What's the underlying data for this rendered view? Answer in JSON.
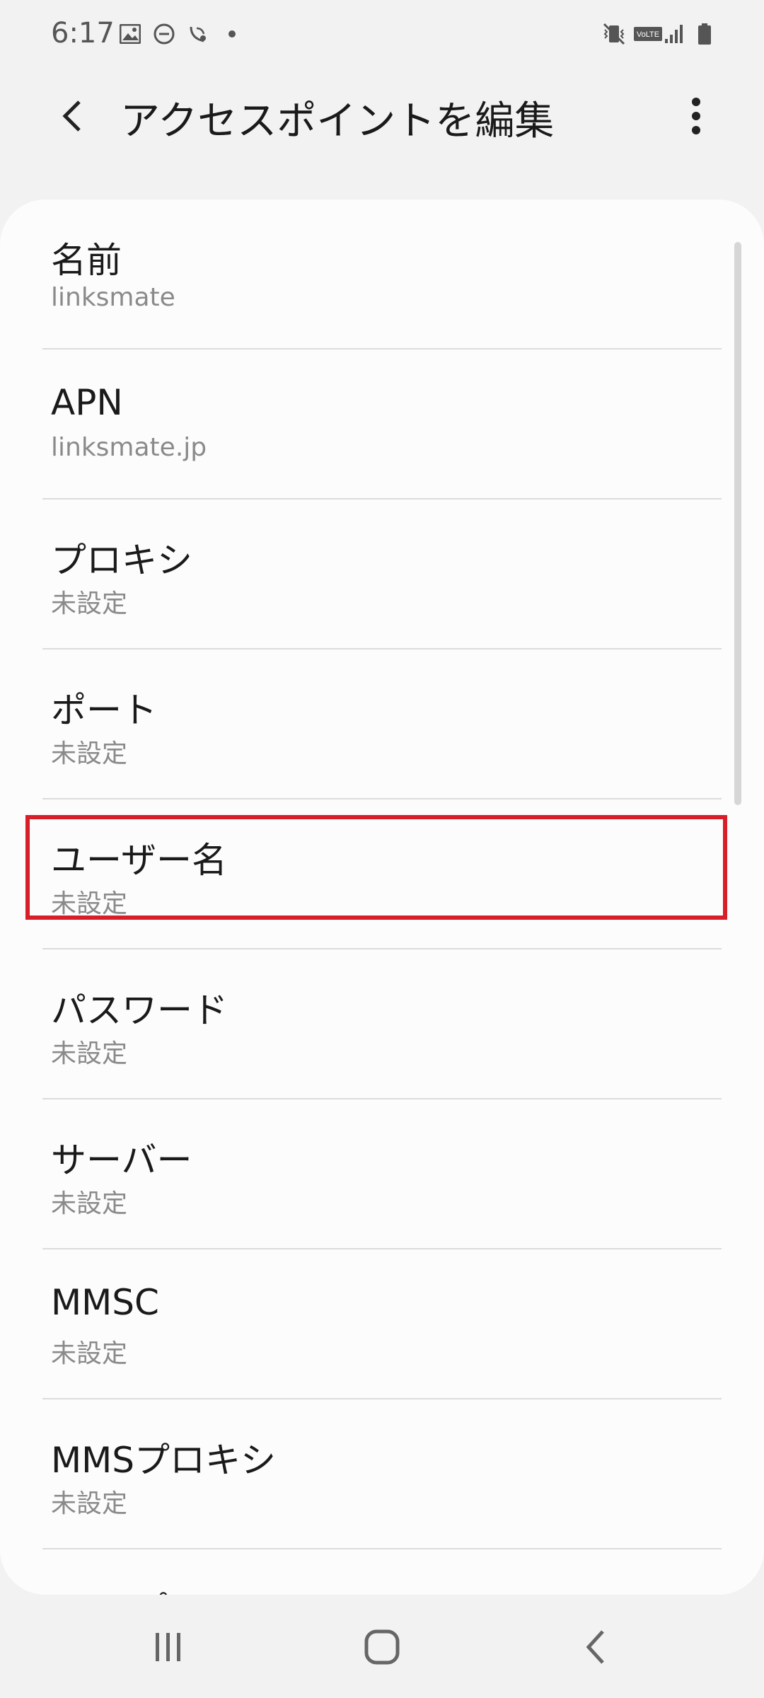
{
  "status_bar": {
    "time": "6:17",
    "left_icons": [
      "image-icon",
      "dnd-icon",
      "wifi-call-icon",
      "dot-icon"
    ],
    "right_icons": [
      "vibrate-icon",
      "volte-icon",
      "signal-icon",
      "battery-icon"
    ],
    "volte_label": "VoLTE"
  },
  "app_bar": {
    "title": "アクセスポイントを編集",
    "back_icon": "back-arrow-icon",
    "more_icon": "more-vert-icon"
  },
  "settings": [
    {
      "title": "名前",
      "value": "linksmate"
    },
    {
      "title": "APN",
      "value": "linksmate.jp"
    },
    {
      "title": "プロキシ",
      "value": "未設定"
    },
    {
      "title": "ポート",
      "value": "未設定"
    },
    {
      "title": "ユーザー名",
      "value": "未設定"
    },
    {
      "title": "パスワード",
      "value": "未設定"
    },
    {
      "title": "サーバー",
      "value": "未設定"
    },
    {
      "title": "MMSC",
      "value": "未設定"
    },
    {
      "title": "MMSプロキシ",
      "value": "未設定"
    },
    {
      "title": "MMSポート",
      "value": ""
    }
  ],
  "highlight_color": "#d81e28",
  "nav_bar": {
    "icons": [
      "recents-icon",
      "home-icon",
      "back-icon"
    ]
  }
}
